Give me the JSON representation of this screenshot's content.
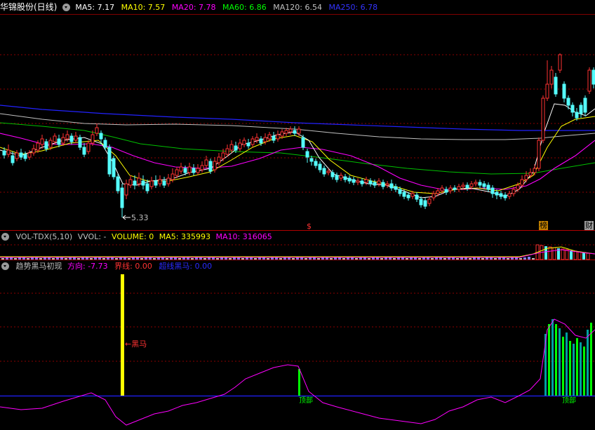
{
  "main": {
    "stock_title": "华锦股份(日线)",
    "ma_legend": [
      {
        "label": "MA5: 7.17",
        "color": "#ffffff"
      },
      {
        "label": "MA10: 7.57",
        "color": "#ffff00"
      },
      {
        "label": "MA20: 7.78",
        "color": "#ff00ff"
      },
      {
        "label": "MA60: 6.86",
        "color": "#00ff00"
      },
      {
        "label": "MA120: 6.54",
        "color": "#c0c0c0"
      },
      {
        "label": "MA250: 6.78",
        "color": "#3333ff"
      }
    ],
    "low_marker": "5.33",
    "markers": {
      "s": "$",
      "bang": "榜",
      "cai": "财"
    }
  },
  "volume": {
    "title": "VOL-TDX(5,10)",
    "vvol": "VVOL: -",
    "volume": "VOLUME: 0",
    "ma5": "MA5: 335993",
    "ma10": "MA10: 316065"
  },
  "indicator": {
    "title": "趋势黑马初现",
    "direction": "方向: -7.73",
    "boundary": "界线: 0.00",
    "super_horse": "超线黑马: 0.00",
    "black_horse_label": "←黑马",
    "bottom_label_1": "顶部",
    "bottom_label_2": "顶部"
  },
  "colors": {
    "up": "#ff3232",
    "down": "#54fcfc",
    "grid": "#8b0000",
    "ma5": "#ffffff",
    "ma10": "#ffff00",
    "ma20": "#ff00ff",
    "ma60": "#00c000",
    "ma120": "#c0c0c0",
    "ma250": "#2222ff",
    "direction_line": "#ff00ff",
    "baseline": "#2020ff",
    "bar_yellow": "#ffff00",
    "bar_green": "#00ff00",
    "bar_teal": "#00a0a0"
  }
}
